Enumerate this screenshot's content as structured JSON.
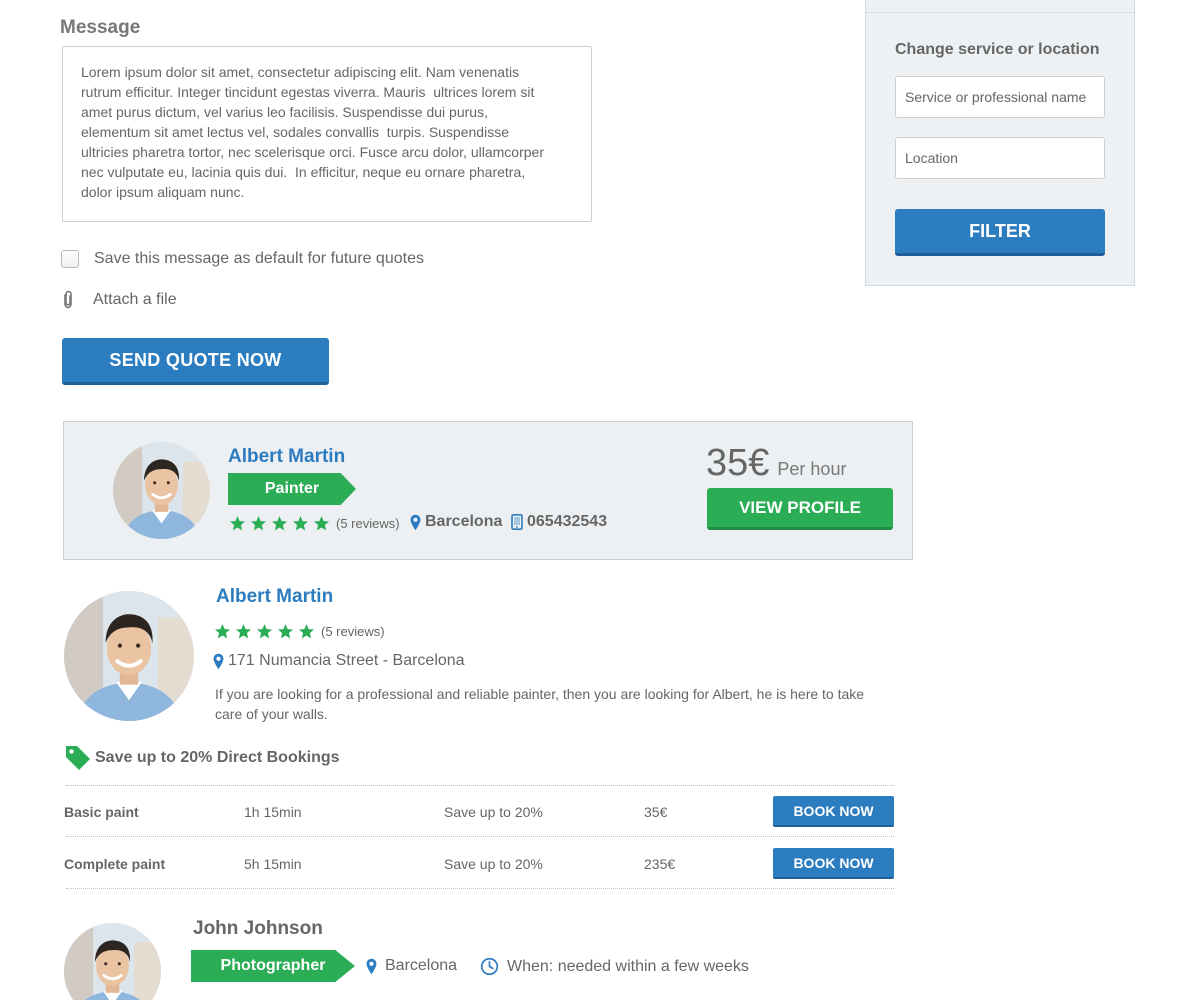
{
  "message": {
    "label": "Message",
    "text": "Lorem ipsum dolor sit amet, consectetur adipiscing elit. Nam venenatis\nrutrum efficitur. Integer tincidunt egestas viverra. Mauris  ultrices lorem sit\namet purus dictum, vel varius leo facilisis. Suspendisse dui purus,\nelementum sit amet lectus vel, sodales convallis  turpis. Suspendisse\nultricies pharetra tortor, nec scelerisque orci. Fusce arcu dolor, ullamcorper\nnec vulputate eu, lacinia quis dui.  In efficitur, neque eu ornare pharetra,\ndolor ipsum aliquam nunc.",
    "save_default_label": "Save this message as default for future quotes",
    "save_default_checked": false,
    "attach_label": "Attach a file",
    "send_button": "SEND QUOTE NOW"
  },
  "sidebar": {
    "title": "Change service or location",
    "service_placeholder": "Service or professional name",
    "location_placeholder": "Location",
    "filter_button": "FILTER"
  },
  "pro_card": {
    "name": "Albert Martin",
    "profession": "Painter",
    "rating": 5,
    "reviews": "(5 reviews)",
    "city": "Barcelona",
    "phone": "065432543",
    "price": "35€",
    "price_unit": "Per hour",
    "view_profile_button": "VIEW PROFILE"
  },
  "pro_detail": {
    "name": "Albert Martin",
    "rating": 5,
    "reviews": "(5 reviews)",
    "address": "171 Numancia Street - Barcelona",
    "description": "If you are looking for a professional and reliable painter, then you are looking for Albert, he is here to take care of your walls.",
    "promo": "Save up to 20% Direct Bookings",
    "services": [
      {
        "name": "Basic paint",
        "duration": "1h 15min",
        "saving": "Save up to 20%",
        "price": "35€",
        "button": "BOOK NOW"
      },
      {
        "name": "Complete paint",
        "duration": "5h 15min",
        "saving": "Save up to 20%",
        "price": "235€",
        "button": "BOOK NOW"
      }
    ]
  },
  "request": {
    "name": "John Johnson",
    "profession": "Photographer",
    "city": "Barcelona",
    "when": "When: needed within a few weeks"
  },
  "colors": {
    "primary_blue": "#2c7cc0",
    "green": "#2bad55",
    "text_gray": "#666666",
    "card_bg": "#edf0f2"
  }
}
